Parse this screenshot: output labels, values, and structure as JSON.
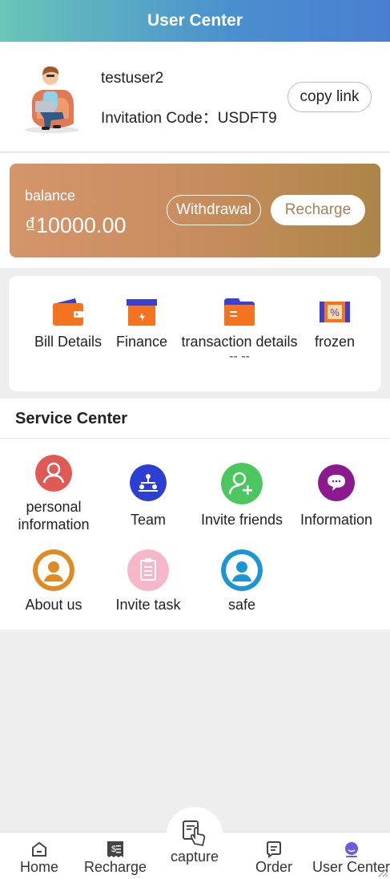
{
  "header": {
    "title": "User Center"
  },
  "profile": {
    "username": "testuser2",
    "invitation_code_label": "Invitation Code：USDFT9",
    "copy_link_label": "copy link"
  },
  "balance": {
    "label": "balance",
    "amount": "₫10000.00",
    "withdraw_label": "Withdrawal",
    "recharge_label": "Recharge",
    "colors": {
      "start": "#d4956a",
      "end": "#ad8548"
    }
  },
  "quick_links": [
    {
      "label": "Bill Details",
      "icon": "wallet-icon"
    },
    {
      "label": "Finance",
      "icon": "finance-box-icon"
    },
    {
      "label": "transaction details",
      "sub": "-- --",
      "icon": "card-icon"
    },
    {
      "label": "frozen",
      "icon": "coupon-icon"
    }
  ],
  "service": {
    "title": "Service Center",
    "items": [
      {
        "label": "personal information",
        "icon": "person-icon",
        "color": "#e05a55"
      },
      {
        "label": "Team",
        "icon": "team-icon",
        "color": "#2d3fd3"
      },
      {
        "label": "Invite friends",
        "icon": "add-user-icon",
        "color": "#4cc760"
      },
      {
        "label": "Information",
        "icon": "chat-icon",
        "color": "#8b1a8e"
      },
      {
        "label": "About us",
        "icon": "about-icon",
        "color": "#e08b22"
      },
      {
        "label": "Invite task",
        "icon": "clipboard-icon",
        "color": "#f7b7c9"
      },
      {
        "label": "safe",
        "icon": "safe-icon",
        "color": "#1a96d6"
      }
    ]
  },
  "tabbar": {
    "home": "Home",
    "recharge": "Recharge",
    "capture": "capture",
    "order": "Order",
    "user_center": "User Center",
    "active_color": "#6a5be0"
  }
}
